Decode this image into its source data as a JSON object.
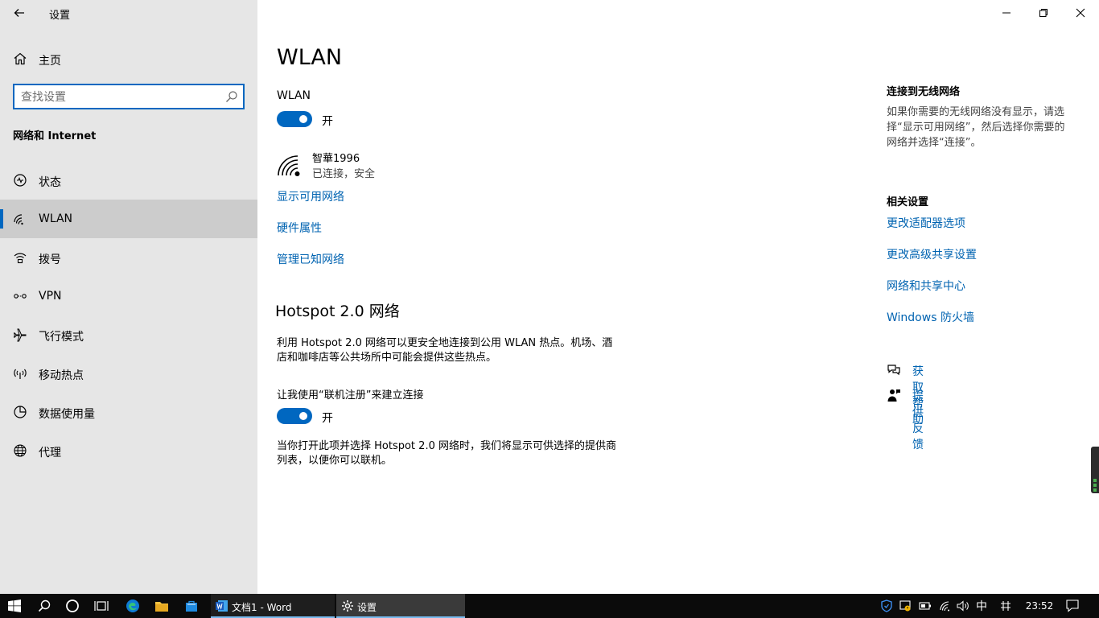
{
  "window": {
    "title": "设置"
  },
  "sidebar": {
    "home_label": "主页",
    "search_placeholder": "查找设置",
    "section_title": "网络和 Internet",
    "items": [
      {
        "label": "状态",
        "icon": "status-icon"
      },
      {
        "label": "WLAN",
        "icon": "wifi-icon",
        "active": true
      },
      {
        "label": "拨号",
        "icon": "dialup-icon"
      },
      {
        "label": "VPN",
        "icon": "vpn-icon"
      },
      {
        "label": "飞行模式",
        "icon": "airplane-icon"
      },
      {
        "label": "移动热点",
        "icon": "hotspot-icon"
      },
      {
        "label": "数据使用量",
        "icon": "data-usage-icon"
      },
      {
        "label": "代理",
        "icon": "globe-icon"
      }
    ]
  },
  "main": {
    "title": "WLAN",
    "wlan_label": "WLAN",
    "wlan_toggle_state": "开",
    "network": {
      "name": "智華1996",
      "status": "已连接，安全"
    },
    "links": {
      "show_networks": "显示可用网络",
      "hardware": "硬件属性",
      "manage_known": "管理已知网络"
    },
    "hotspot": {
      "title": "Hotspot 2.0 网络",
      "desc_line1": "利用 Hotspot 2.0 网络可以更安全地连接到公用 WLAN 热点。机场、酒",
      "desc_line2": "店和咖啡店等公共场所中可能会提供这些热点。",
      "online_signup_label": "让我使用“联机注册”来建立连接",
      "online_signup_state": "开",
      "note_line1": "当你打开此项并选择 Hotspot 2.0 网络时，我们将显示可供选择的提供商",
      "note_line2": "列表，以便你可以联机。"
    }
  },
  "right": {
    "connect_title": "连接到无线网络",
    "connect_desc_1": "如果你需要的无线网络没有显示，请选",
    "connect_desc_2": "择“显示可用网络”，然后选择你需要的",
    "connect_desc_3": "网络并选择“连接”。",
    "related_title": "相关设置",
    "related_links": [
      "更改适配器选项",
      "更改高级共享设置",
      "网络和共享中心",
      "Windows 防火墙"
    ],
    "help_label": "获取帮助",
    "feedback_label": "提供反馈"
  },
  "taskbar": {
    "word_label": "文档1 - Word",
    "settings_label": "设置",
    "ime": "中",
    "time": "23:52"
  },
  "colors": {
    "accent": "#0067c0",
    "link": "#0063b1",
    "sidebar_bg": "#e6e6e6",
    "taskbar_bg": "#0b0b0b"
  }
}
